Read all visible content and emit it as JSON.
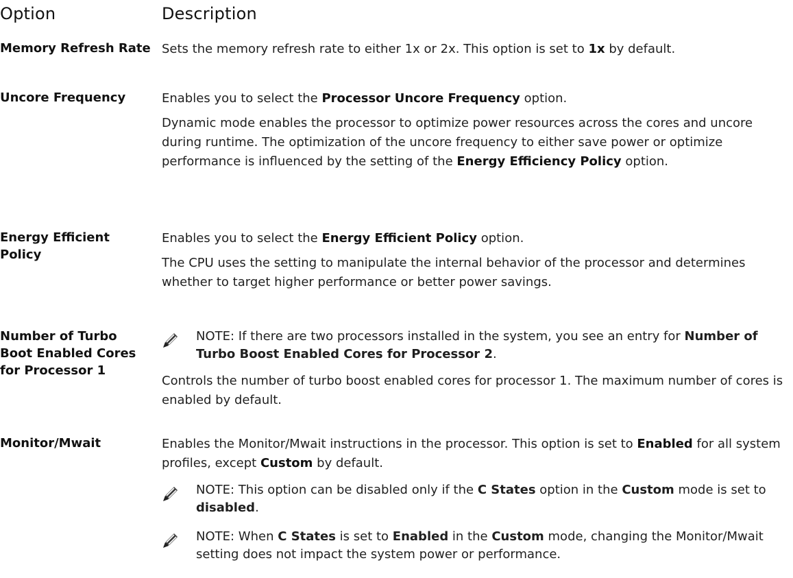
{
  "header": {
    "option": "Option",
    "description": "Description"
  },
  "rows": [
    {
      "option": "Memory Refresh Rate",
      "desc": [
        {
          "pre": "Sets the memory refresh rate to either 1x or 2x. This option is set to ",
          "b": "1x",
          "post": " by default."
        }
      ]
    },
    {
      "option": "Uncore Frequency",
      "desc": [
        {
          "pre": "Enables you to select the ",
          "b": "Processor Uncore Frequency",
          "post": " option."
        },
        {
          "pre": "Dynamic mode enables the processor to optimize power resources across the cores and uncore during runtime. The optimization of the uncore frequency to either save power or optimize performance is influenced by the setting of the ",
          "b": "Energy Efficiency Policy",
          "post": " option."
        }
      ]
    },
    {
      "option": "Energy Efficient Policy",
      "desc": [
        {
          "pre": "Enables you to select the ",
          "b": "Energy Efficient Policy",
          "post": " option."
        },
        {
          "pre": "The CPU uses the setting to manipulate the internal behavior of the processor and determines whether to target higher performance or better power savings.",
          "b": "",
          "post": ""
        }
      ]
    },
    {
      "option": "Number of Turbo Boot Enabled Cores for Processor 1",
      "note": {
        "label": "NOTE:",
        "pre": " If there are two processors installed in the system, you see an entry for ",
        "b": "Number of Turbo Boost Enabled Cores for Processor 2",
        "post": "."
      },
      "desc": [
        {
          "pre": "Controls the number of turbo boost enabled cores for processor 1. The maximum number of cores is enabled by default.",
          "b": "",
          "post": ""
        }
      ]
    },
    {
      "option": "Monitor/Mwait",
      "desc": [
        {
          "pre": "Enables the Monitor/Mwait instructions in the processor. This option is set to ",
          "b": "Enabled",
          "post": " for all system profiles, except ",
          "b2": "Custom",
          "post2": " by default."
        }
      ],
      "notes": [
        {
          "label": "NOTE:",
          "t1": " This option can be disabled only if the ",
          "b1": "C States",
          "t2": " option in the ",
          "b2": "Custom",
          "t3": " mode is set to ",
          "b3": "disabled",
          "t4": "."
        },
        {
          "label": "NOTE:",
          "t1": " When ",
          "b1": "C States",
          "t2": " is set to ",
          "b2": "Enabled",
          "t3": " in the ",
          "b3": "Custom",
          "t4": " mode, changing the Monitor/Mwait setting does not impact the system power or performance."
        }
      ]
    }
  ],
  "icons": {
    "note": "pencil-note-icon"
  }
}
